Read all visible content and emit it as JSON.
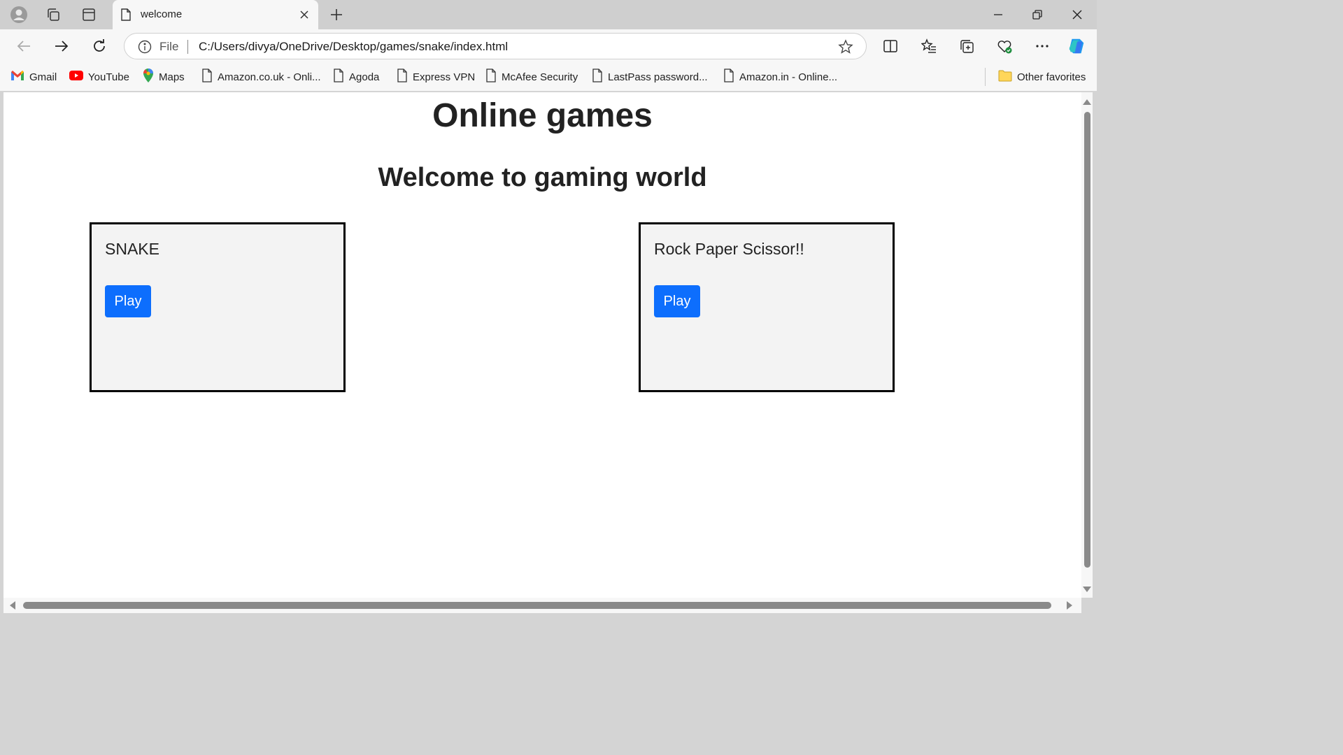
{
  "tab": {
    "title": "welcome"
  },
  "address_bar": {
    "scheme_label": "File",
    "url": "C:/Users/divya/OneDrive/Desktop/games/snake/index.html"
  },
  "bookmarks": [
    {
      "label": "Gmail",
      "icon": "gmail-icon"
    },
    {
      "label": "YouTube",
      "icon": "youtube-icon"
    },
    {
      "label": "Maps",
      "icon": "maps-icon"
    },
    {
      "label": "Amazon.co.uk - Onli...",
      "icon": "page-icon"
    },
    {
      "label": "Agoda",
      "icon": "page-icon"
    },
    {
      "label": "Express VPN",
      "icon": "page-icon"
    },
    {
      "label": "McAfee Security",
      "icon": "page-icon"
    },
    {
      "label": "LastPass password...",
      "icon": "page-icon"
    },
    {
      "label": "Amazon.in - Online...",
      "icon": "page-icon"
    }
  ],
  "other_favorites": {
    "label": "Other favorites",
    "icon": "folder-icon"
  },
  "page": {
    "heading": "Online games",
    "subheading": "Welcome to gaming world",
    "cards": [
      {
        "title": "SNAKE",
        "button": "Play"
      },
      {
        "title": "Rock Paper Scissor!!",
        "button": "Play"
      }
    ]
  },
  "colors": {
    "play_button": "#0d6efd",
    "card_bg": "#f3f3f3",
    "card_border": "#000000"
  }
}
